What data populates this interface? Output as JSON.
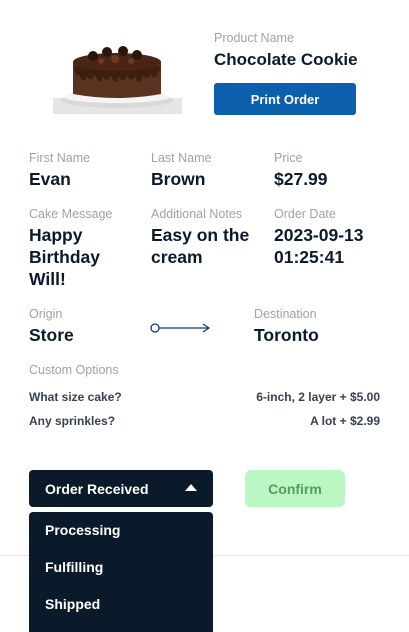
{
  "product": {
    "name_label": "Product Name",
    "name": "Chocolate Cookie",
    "print_label": "Print Order"
  },
  "customer": {
    "first_label": "First Name",
    "first": "Evan",
    "last_label": "Last Name",
    "last": "Brown",
    "price_label": "Price",
    "price": "$27.99"
  },
  "details": {
    "message_label": "Cake Message",
    "message": "Happy Birthday Will!",
    "notes_label": "Additional Notes",
    "notes": "Easy on the cream",
    "date_label": "Order Date",
    "date": "2023-09-13 01:25:41"
  },
  "route": {
    "origin_label": "Origin",
    "origin": "Store",
    "destination_label": "Destination",
    "destination": "Toronto"
  },
  "custom_options": {
    "label": "Custom Options",
    "items": [
      {
        "question": "What size cake?",
        "answer": "6-inch, 2 layer + $5.00"
      },
      {
        "question": "Any sprinkles?",
        "answer": "A lot + $2.99"
      }
    ]
  },
  "status": {
    "selected": "Order Received",
    "options": [
      "Processing",
      "Fulfilling",
      "Shipped"
    ],
    "confirm_label": "Confirm"
  },
  "colors": {
    "primary": "#0b5fad",
    "dark": "#0a1a2a",
    "confirm_bg": "#bbf7c4",
    "confirm_text": "#4ea05a"
  }
}
